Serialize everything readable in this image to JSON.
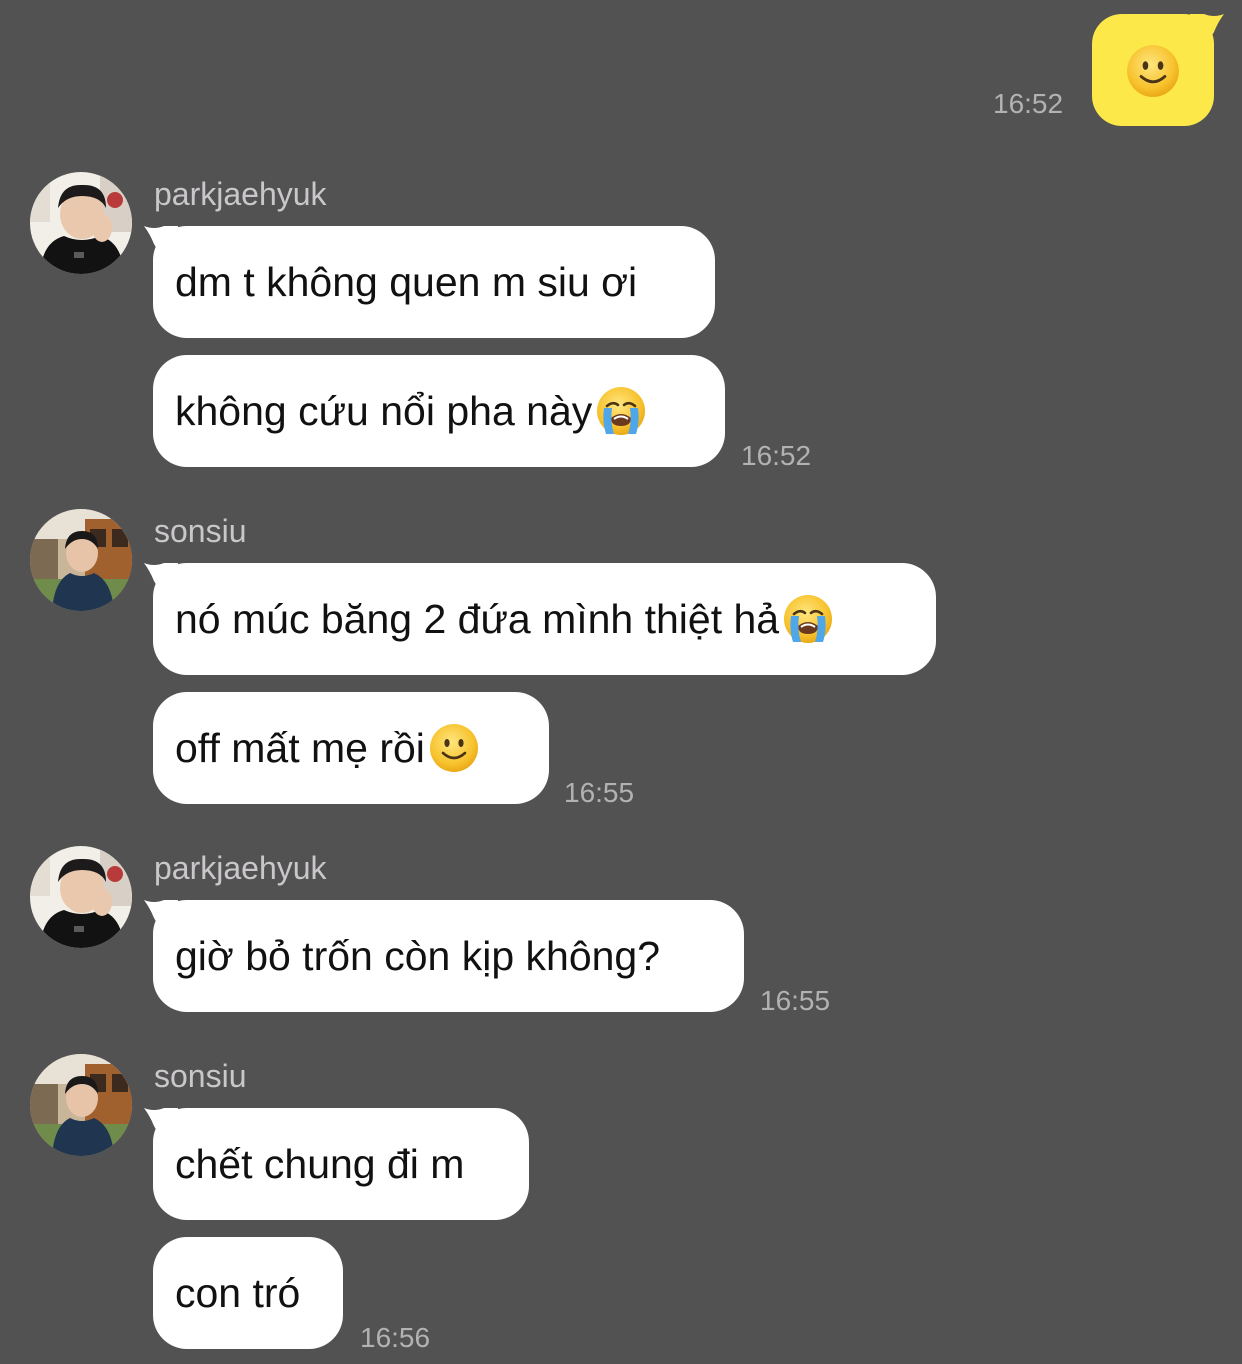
{
  "sent": {
    "emoji_icon": "slightly-smiling-face-icon",
    "time": "16:52",
    "bubble_color": "#fde84a"
  },
  "groups": [
    {
      "sender": "parkjaehyuk",
      "avatar_icon": "user-avatar-parkjaehyuk",
      "messages": [
        {
          "text": "dm t không quen m siu ơi"
        },
        {
          "text": "không cứu nổi pha này",
          "emoji_icon": "loudly-crying-face-icon"
        }
      ],
      "time": "16:52"
    },
    {
      "sender": "sonsiu",
      "avatar_icon": "user-avatar-sonsiu",
      "messages": [
        {
          "text": "nó múc băng 2 đứa mình thiệt hả",
          "emoji_icon": "loudly-crying-face-icon"
        },
        {
          "text": "off mất mẹ rồi",
          "emoji_icon": "slightly-smiling-face-icon"
        }
      ],
      "time": "16:55"
    },
    {
      "sender": "parkjaehyuk",
      "avatar_icon": "user-avatar-parkjaehyuk",
      "messages": [
        {
          "text": "giờ bỏ trốn còn kịp không?"
        }
      ],
      "time": "16:55"
    },
    {
      "sender": "sonsiu",
      "avatar_icon": "user-avatar-sonsiu",
      "messages": [
        {
          "text": "chết chung đi m"
        },
        {
          "text": "con tró"
        }
      ],
      "time": "16:56"
    }
  ],
  "colors": {
    "background": "#535253",
    "received_bubble": "#ffffff",
    "timestamp": "#b3b1b3",
    "sender_name": "#c9c7c9"
  }
}
